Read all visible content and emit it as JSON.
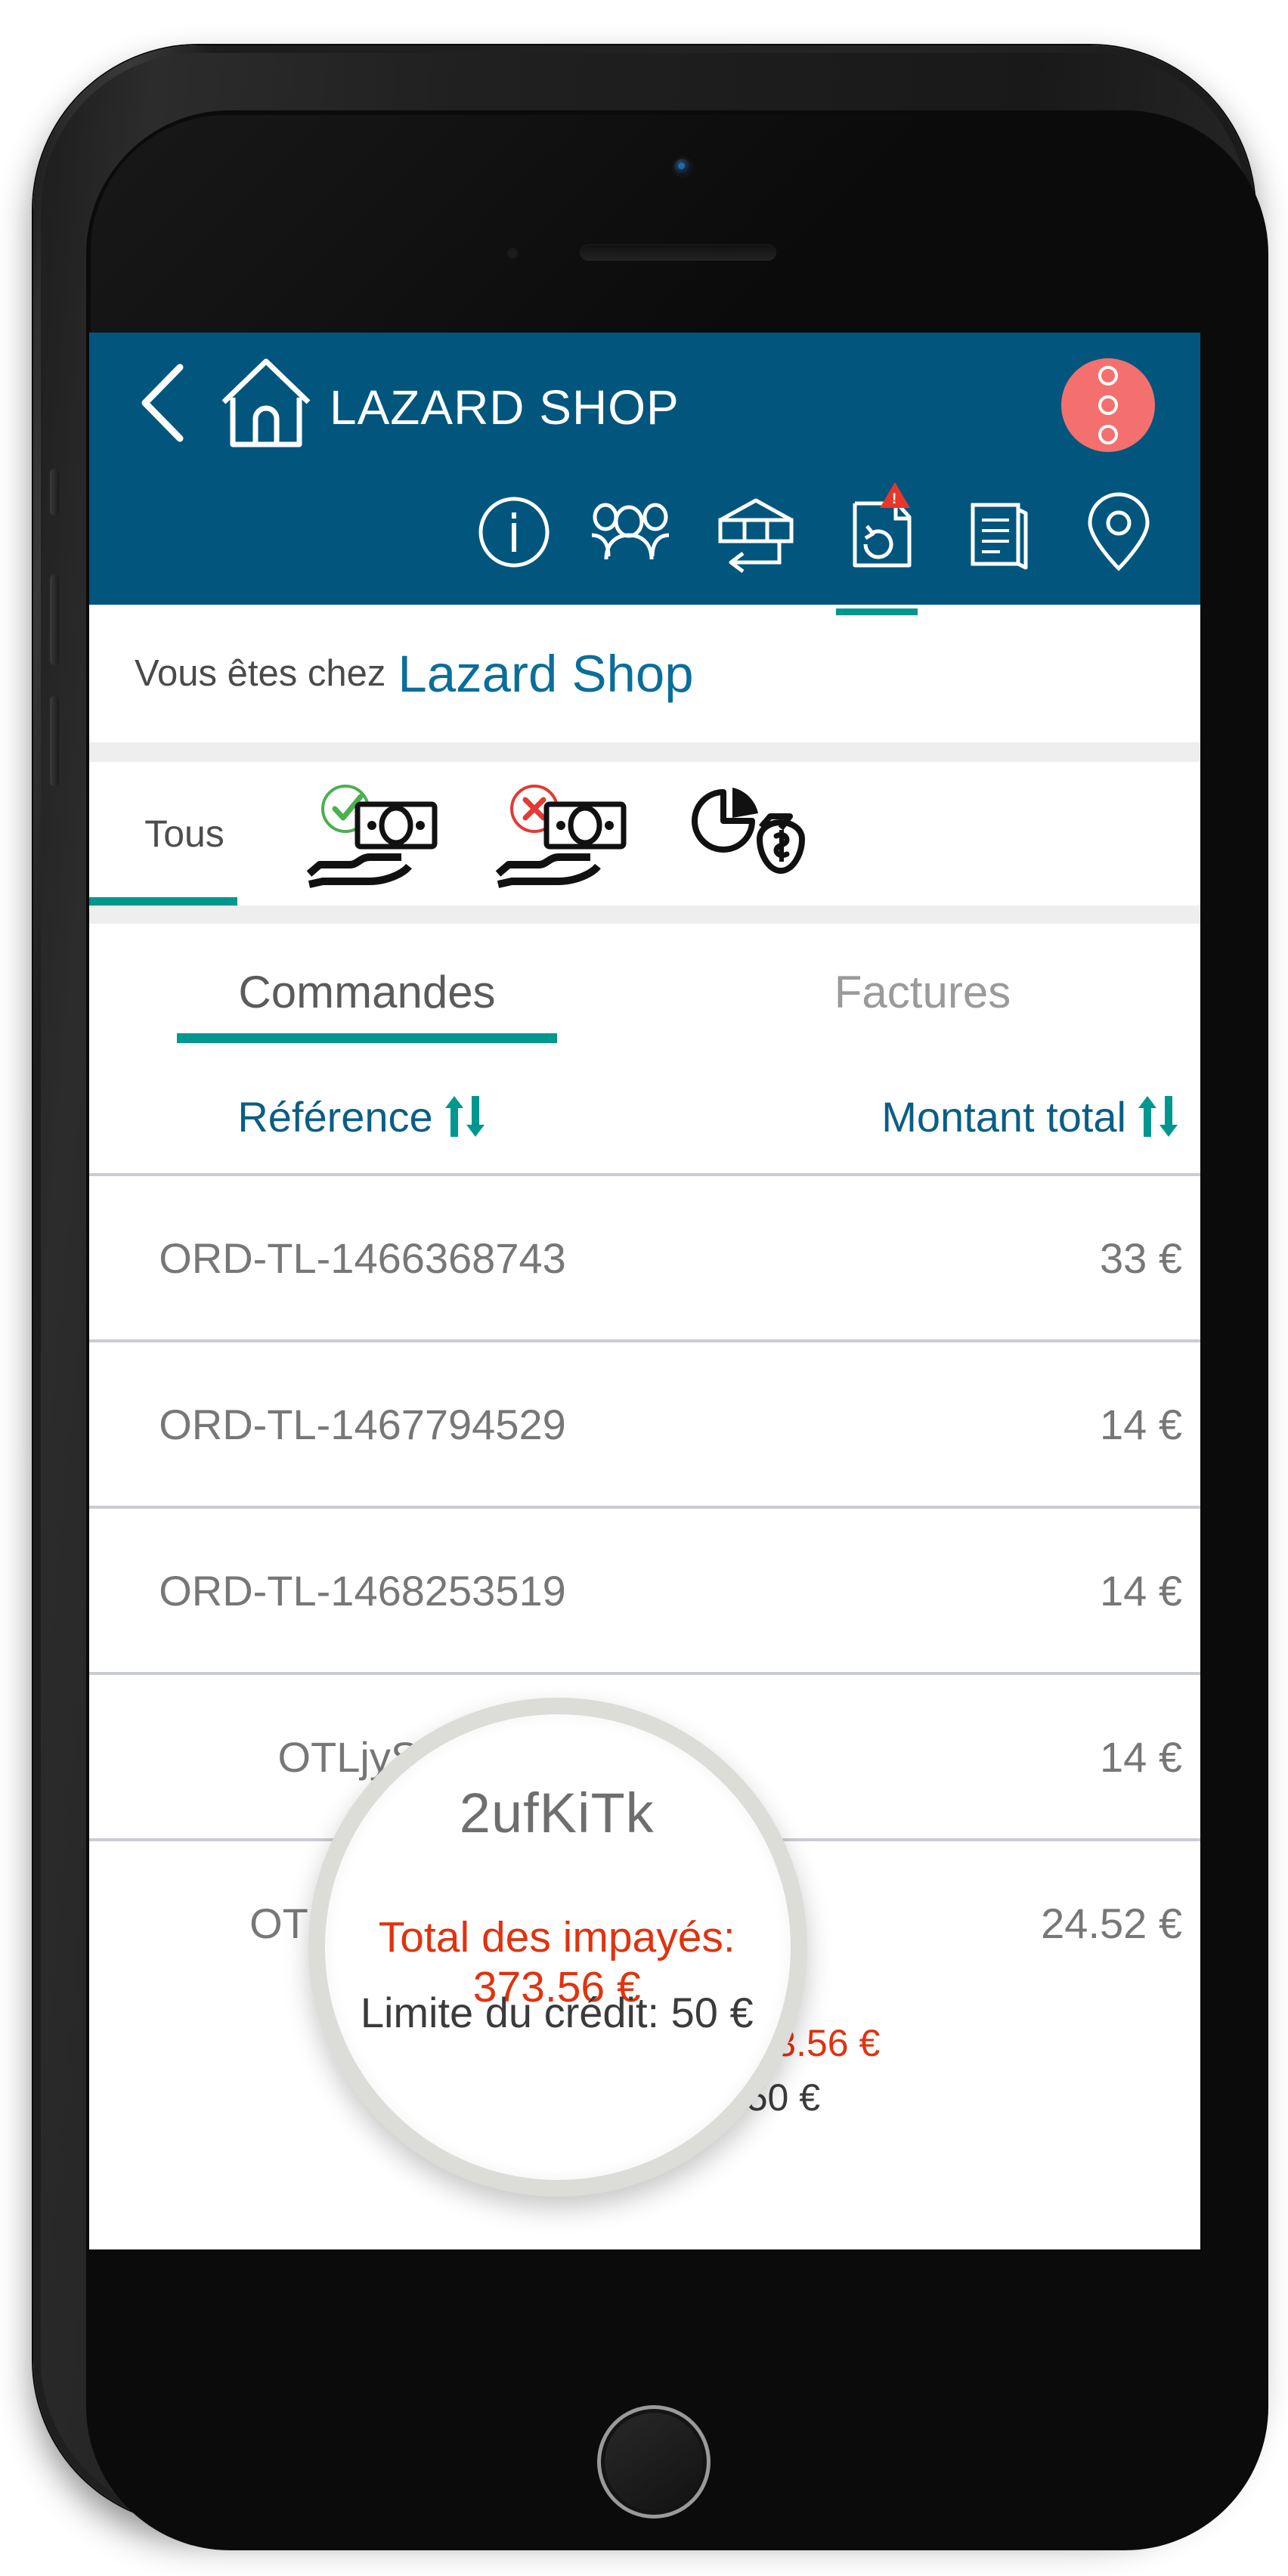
{
  "header": {
    "title": "LAZARD SHOP",
    "back_icon": "chevron-left-icon",
    "home_icon": "home-icon",
    "menu_icon": "kebab-menu-icon",
    "menu_color": "#f4706e",
    "bar_color": "#02567d"
  },
  "icon_tabs": [
    {
      "name": "info",
      "icon": "info-circle-icon",
      "active": false,
      "badge": false
    },
    {
      "name": "contacts",
      "icon": "users-icon",
      "active": false,
      "badge": false
    },
    {
      "name": "returns",
      "icon": "package-return-icon",
      "active": false,
      "badge": false
    },
    {
      "name": "documents",
      "icon": "document-sync-icon",
      "active": true,
      "badge": true,
      "badge_label": "!"
    },
    {
      "name": "notes",
      "icon": "notebook-icon",
      "active": false,
      "badge": false
    },
    {
      "name": "location",
      "icon": "map-pin-icon",
      "active": false,
      "badge": false
    }
  ],
  "breadcrumb": {
    "prefix": "Vous êtes chez",
    "shop": "Lazard Shop"
  },
  "filters": {
    "all_label": "Tous",
    "items": [
      {
        "name": "paid",
        "icon": "paid-cash-hand-icon",
        "active": false
      },
      {
        "name": "unpaid",
        "icon": "unpaid-cash-hand-icon",
        "active": false
      },
      {
        "name": "partial",
        "icon": "money-bag-chart-icon",
        "active": false
      }
    ]
  },
  "tabs": [
    {
      "label": "Commandes",
      "active": true
    },
    {
      "label": "Factures",
      "active": false
    }
  ],
  "table": {
    "columns": [
      {
        "label": "Référence",
        "sort_icon": "sort-updown-icon"
      },
      {
        "label": "Montant total",
        "sort_icon": "sort-updown-icon"
      }
    ],
    "rows": [
      {
        "reference": "ORD-TL-1466368743",
        "amount": "33 €"
      },
      {
        "reference": "ORD-TL-1467794529",
        "amount": "14 €"
      },
      {
        "reference": "ORD-TL-1468253519",
        "amount": "14 €"
      },
      {
        "reference": "OTLjySP",
        "amount": "14 €"
      },
      {
        "reference": "OTL2ufKiTk",
        "amount": "24.52 €"
      }
    ]
  },
  "totals": {
    "unpaid": "Total des impayés: 373.56 €",
    "limit": "Limite du crédit: 50 €",
    "unpaid_color": "#e0330f"
  },
  "magnifier": {
    "reference": "2ufKiTk",
    "unpaid": "Total des impayés: 373.56 €",
    "limit": "Limite du crédit: 50 €"
  },
  "theme": {
    "accent_teal": "#00978f",
    "link_blue": "#0b5e85",
    "app_blue": "#02567d"
  }
}
